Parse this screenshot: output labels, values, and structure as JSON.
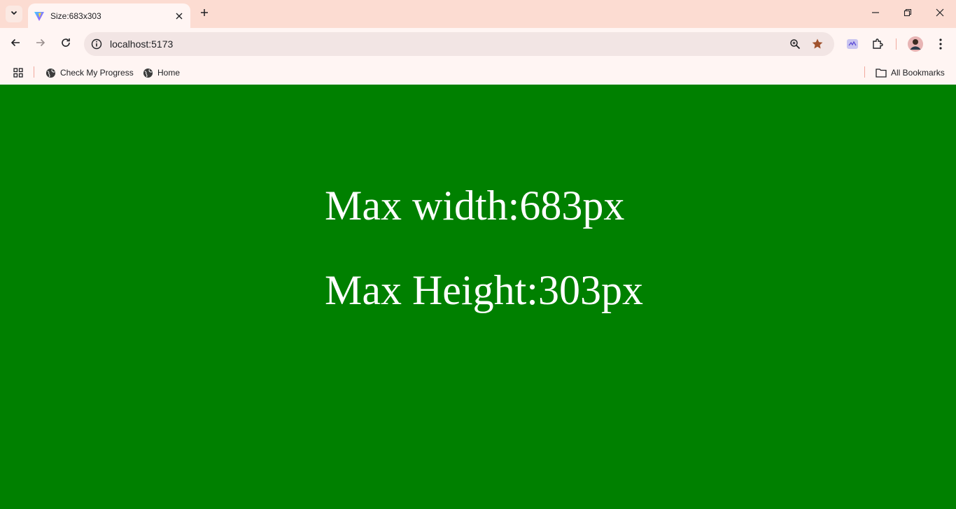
{
  "browser": {
    "tab": {
      "title": "Size:683x303"
    },
    "address_bar": {
      "url": "localhost:5173"
    },
    "bookmarks": [
      {
        "label": "Check My Progress"
      },
      {
        "label": "Home"
      }
    ],
    "all_bookmarks_label": "All Bookmarks"
  },
  "page": {
    "max_width_text": "Max width:683px",
    "max_height_text": "Max Height:303px",
    "background_color": "#008000",
    "text_color": "#ffffff"
  },
  "colors": {
    "tabstrip": "#fcdcd2",
    "toolbar": "#fff5f3",
    "omnibox": "#f2e5e4",
    "star": "#a0522d"
  }
}
